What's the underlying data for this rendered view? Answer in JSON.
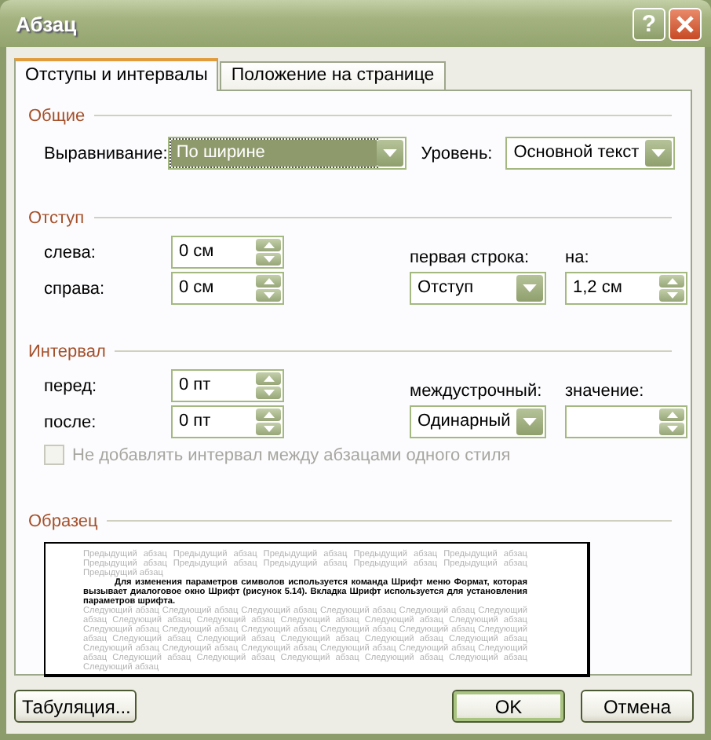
{
  "window": {
    "title": "Абзац",
    "help": "?"
  },
  "tabs": [
    {
      "label": "Отступы и интервалы",
      "selected": true
    },
    {
      "label": "Положение на странице",
      "selected": false
    }
  ],
  "general": {
    "heading": "Общие",
    "alignment": {
      "label": "Выравнивание:",
      "value": "По ширине",
      "focused": true
    },
    "level": {
      "label": "Уровень:",
      "value": "Основной текст",
      "focused": false
    }
  },
  "indent": {
    "heading": "Отступ",
    "left": {
      "label": "слева:",
      "value": "0 см"
    },
    "right": {
      "label": "справа:",
      "value": "0 см"
    },
    "first_line": {
      "label": "первая строка:",
      "value": "Отступ"
    },
    "by": {
      "label": "на:",
      "value": "1,2 см"
    }
  },
  "spacing": {
    "heading": "Интервал",
    "before": {
      "label": "перед:",
      "value": "0 пт"
    },
    "after": {
      "label": "после:",
      "value": "0 пт"
    },
    "line_spacing": {
      "label": "междустрочный:",
      "value": "Одинарный"
    },
    "at": {
      "label": "значение:"
    },
    "same_style": {
      "label": "Не добавлять интервал между абзацами одного стиля",
      "checked": false,
      "disabled": true
    }
  },
  "preview": {
    "heading": "Образец",
    "previous": "Предыдущий абзац Предыдущий абзац Предыдущий абзац Предыдущий абзац Предыдущий абзац Предыдущий абзац Предыдущий абзац Предыдущий абзац Предыдущий абзац Предыдущий абзац Предыдущий абзац",
    "current": "Для изменения параметров символов используется команда Шрифт меню Формат, которая вызывает диалоговое окно Шрифт (рисунок 5.14). Вкладка Шрифт используется для установления параметров шрифта.",
    "next": "Следующий абзац Следующий абзац Следующий абзац Следующий абзац Следующий абзац Следующий абзац Следующий абзац Следующий абзац Следующий абзац Следующий абзац Следующий абзац Следующий абзац Следующий абзац Следующий абзац Следующий абзац Следующий абзац Следующий абзац Следующий абзац Следующий абзац Следующий абзац Следующий абзац Следующий абзац Следующий абзац Следующий абзац Следующий абзац Следующий абзац Следующий абзац Следующий абзац Следующий абзац Следующий абзац Следующий абзац Следующий абзац Следующий абзац Следующий абзац"
  },
  "buttons": [
    {
      "label": "Табуляция...",
      "default": false
    },
    {
      "label": "OK",
      "default": true
    },
    {
      "label": "Отмена",
      "default": false
    }
  ]
}
